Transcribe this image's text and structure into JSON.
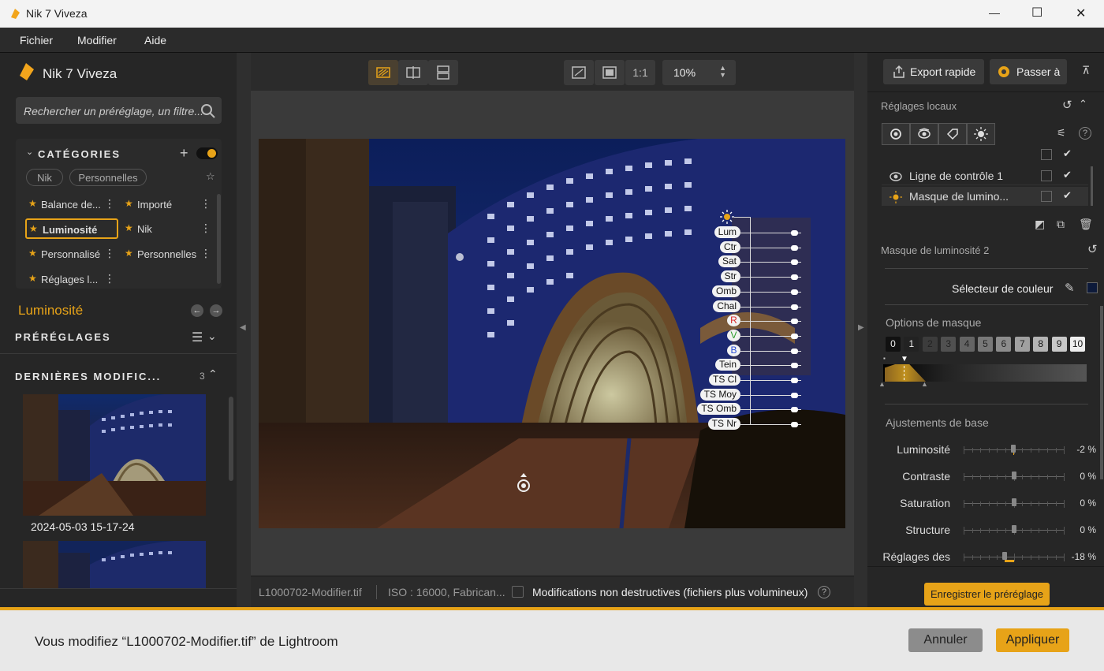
{
  "window": {
    "title": "Nik 7 Viveza",
    "minimize": "—",
    "maximize": "☐",
    "close": "✕"
  },
  "menu": [
    "Fichier",
    "Modifier",
    "Aide"
  ],
  "left": {
    "app_name": "Nik 7 Viveza",
    "search_placeholder": "Rechercher un préréglage, un filtre...",
    "categories_label": "CATÉGORIES",
    "filter_pills": [
      "Nik",
      "Personnelles"
    ],
    "categories": [
      {
        "label": "Balance de...",
        "selected": false
      },
      {
        "label": "Importé",
        "selected": false
      },
      {
        "label": "Luminosité",
        "selected": true
      },
      {
        "label": "Nik",
        "selected": false
      },
      {
        "label": "Personnalisé",
        "selected": false
      },
      {
        "label": "Personnelles",
        "selected": false
      },
      {
        "label": "Réglages l...",
        "selected": false
      }
    ],
    "active_category": "Luminosité",
    "presets_label": "PRÉRÉGLAGES",
    "recent_label": "DERNIÈRES MODIFIC...",
    "recent_count": "3",
    "recent_items": [
      {
        "date": "2024-05-03 15-17-24"
      }
    ]
  },
  "toolbar": {
    "ratio": "1:1",
    "zoom": "10%"
  },
  "control_point": {
    "labels": [
      "Lum",
      "Ctr",
      "Sat",
      "Str",
      "Omb",
      "Chal",
      "R",
      "V",
      "B",
      "Tein",
      "TS Cl",
      "TS Moy",
      "TS Omb",
      "TS Nr"
    ],
    "rgb_colors": {
      "R": "#d62828",
      "V": "#2a9d2a",
      "B": "#2a4fd6"
    }
  },
  "status": {
    "filename": "L1000702-Modifier.tif",
    "iso": "ISO : 16000, Fabrican...",
    "nondestructive_label": "Modifications non destructives (fichiers plus volumineux)",
    "nondestructive_checked": false
  },
  "right": {
    "export_label": "Export rapide",
    "passer_label": "Passer à",
    "local_title": "Réglages locaux",
    "layers": [
      {
        "name": "Ligne de contrôle 1",
        "checked": true
      },
      {
        "name": "Masque de lumino...",
        "checked": true
      }
    ],
    "mask_name": "Masque de luminosité 2",
    "color_selector": "Sélecteur de couleur",
    "mask_options": "Options de masque",
    "mask_numbers": [
      "0",
      "1",
      "2",
      "3",
      "4",
      "5",
      "6",
      "7",
      "8",
      "9",
      "10"
    ],
    "base_adjust": "Ajustements de base",
    "adjustments": [
      {
        "label": "Luminosité",
        "value": "-2 %",
        "level": -0.02
      },
      {
        "label": "Contraste",
        "value": "0 %",
        "level": 0
      },
      {
        "label": "Saturation",
        "value": "0 %",
        "level": 0
      },
      {
        "label": "Structure",
        "value": "0 %",
        "level": 0
      },
      {
        "label": "Réglages des",
        "value": "-18 %",
        "level": -0.18
      }
    ],
    "save_preset": "Enregistrer le préréglage"
  },
  "bottom": {
    "message": "Vous modifiez “L1000702-Modifier.tif” de Lightroom",
    "cancel": "Annuler",
    "apply": "Appliquer"
  },
  "colors": {
    "accent": "#e7a318"
  }
}
